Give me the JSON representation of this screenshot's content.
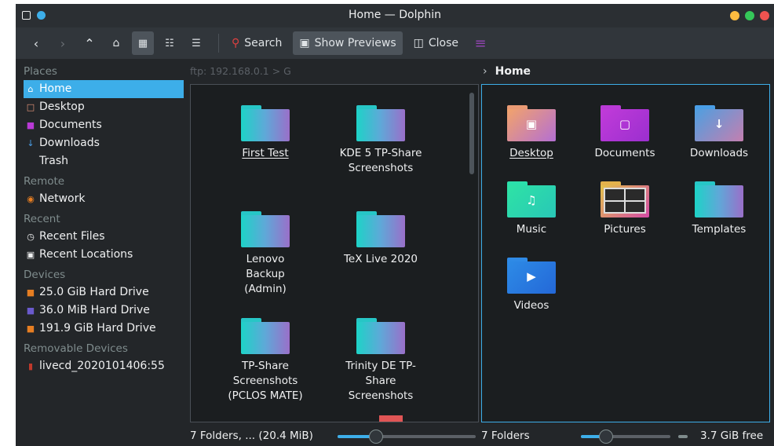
{
  "window": {
    "title": "Home — Dolphin",
    "controls_colors": [
      "#fdbc40",
      "#35c759",
      "#ef5350"
    ]
  },
  "toolbar": {
    "back_icon": "back-icon",
    "forward_icon": "forward-icon",
    "up_icon": "up-icon",
    "home_icon": "home-icon",
    "search_label": "Search",
    "show_previews_label": "Show Previews",
    "close_label": "Close"
  },
  "sidebar": {
    "places_header": "Places",
    "places": [
      {
        "label": "Home",
        "icon": "home-icon",
        "selected": true
      },
      {
        "label": "Desktop",
        "icon": "desktop-icon"
      },
      {
        "label": "Documents",
        "icon": "documents-icon"
      },
      {
        "label": "Downloads",
        "icon": "downloads-icon"
      },
      {
        "label": "Trash",
        "icon": "trash-icon"
      }
    ],
    "remote_header": "Remote",
    "remote": [
      {
        "label": "Network",
        "icon": "network-icon"
      }
    ],
    "recent_header": "Recent",
    "recent": [
      {
        "label": "Recent Files",
        "icon": "clock-icon"
      },
      {
        "label": "Recent Locations",
        "icon": "location-icon"
      }
    ],
    "devices_header": "Devices",
    "devices": [
      {
        "label": "25.0 GiB Hard Drive",
        "icon": "drive-icon"
      },
      {
        "label": "36.0 MiB Hard Drive",
        "icon": "drive-icon"
      },
      {
        "label": "191.9 GiB Hard Drive",
        "icon": "drive-icon"
      }
    ],
    "removable_header": "Removable Devices",
    "removable": [
      {
        "label": "livecd_2020101406:55",
        "icon": "usb-icon"
      }
    ]
  },
  "left_pane": {
    "location": "ftp: 192.168.0.1  >  G",
    "items": [
      {
        "name": "First Test"
      },
      {
        "name": "KDE 5 TP-Share Screenshots"
      },
      {
        "name": "Lenovo Backup (Admin)"
      },
      {
        "name": "TeX Live 2020"
      },
      {
        "name": "TP-Share Screenshots (PCLOS MATE)"
      },
      {
        "name": "Trinity DE TP-Share Screenshots"
      }
    ],
    "status": "7 Folders, ... (20.4 MiB)",
    "zoom_fraction": 0.28
  },
  "right_pane": {
    "location": "Home",
    "items": [
      {
        "name": "Desktop",
        "icon": "desktop-folder-icon"
      },
      {
        "name": "Documents",
        "icon": "documents-folder-icon"
      },
      {
        "name": "Downloads",
        "icon": "downloads-folder-icon"
      },
      {
        "name": "Music",
        "icon": "music-folder-icon"
      },
      {
        "name": "Pictures",
        "icon": "pictures-folder-icon"
      },
      {
        "name": "Templates",
        "icon": "templates-folder-icon"
      },
      {
        "name": "Videos",
        "icon": "videos-folder-icon"
      }
    ],
    "status": "7 Folders",
    "zoom_fraction": 0.28,
    "free_space": "3.7 GiB free"
  },
  "colors": {
    "accent": "#3daee9",
    "window_bg": "#232629",
    "pane_bg": "#1b1e20"
  }
}
